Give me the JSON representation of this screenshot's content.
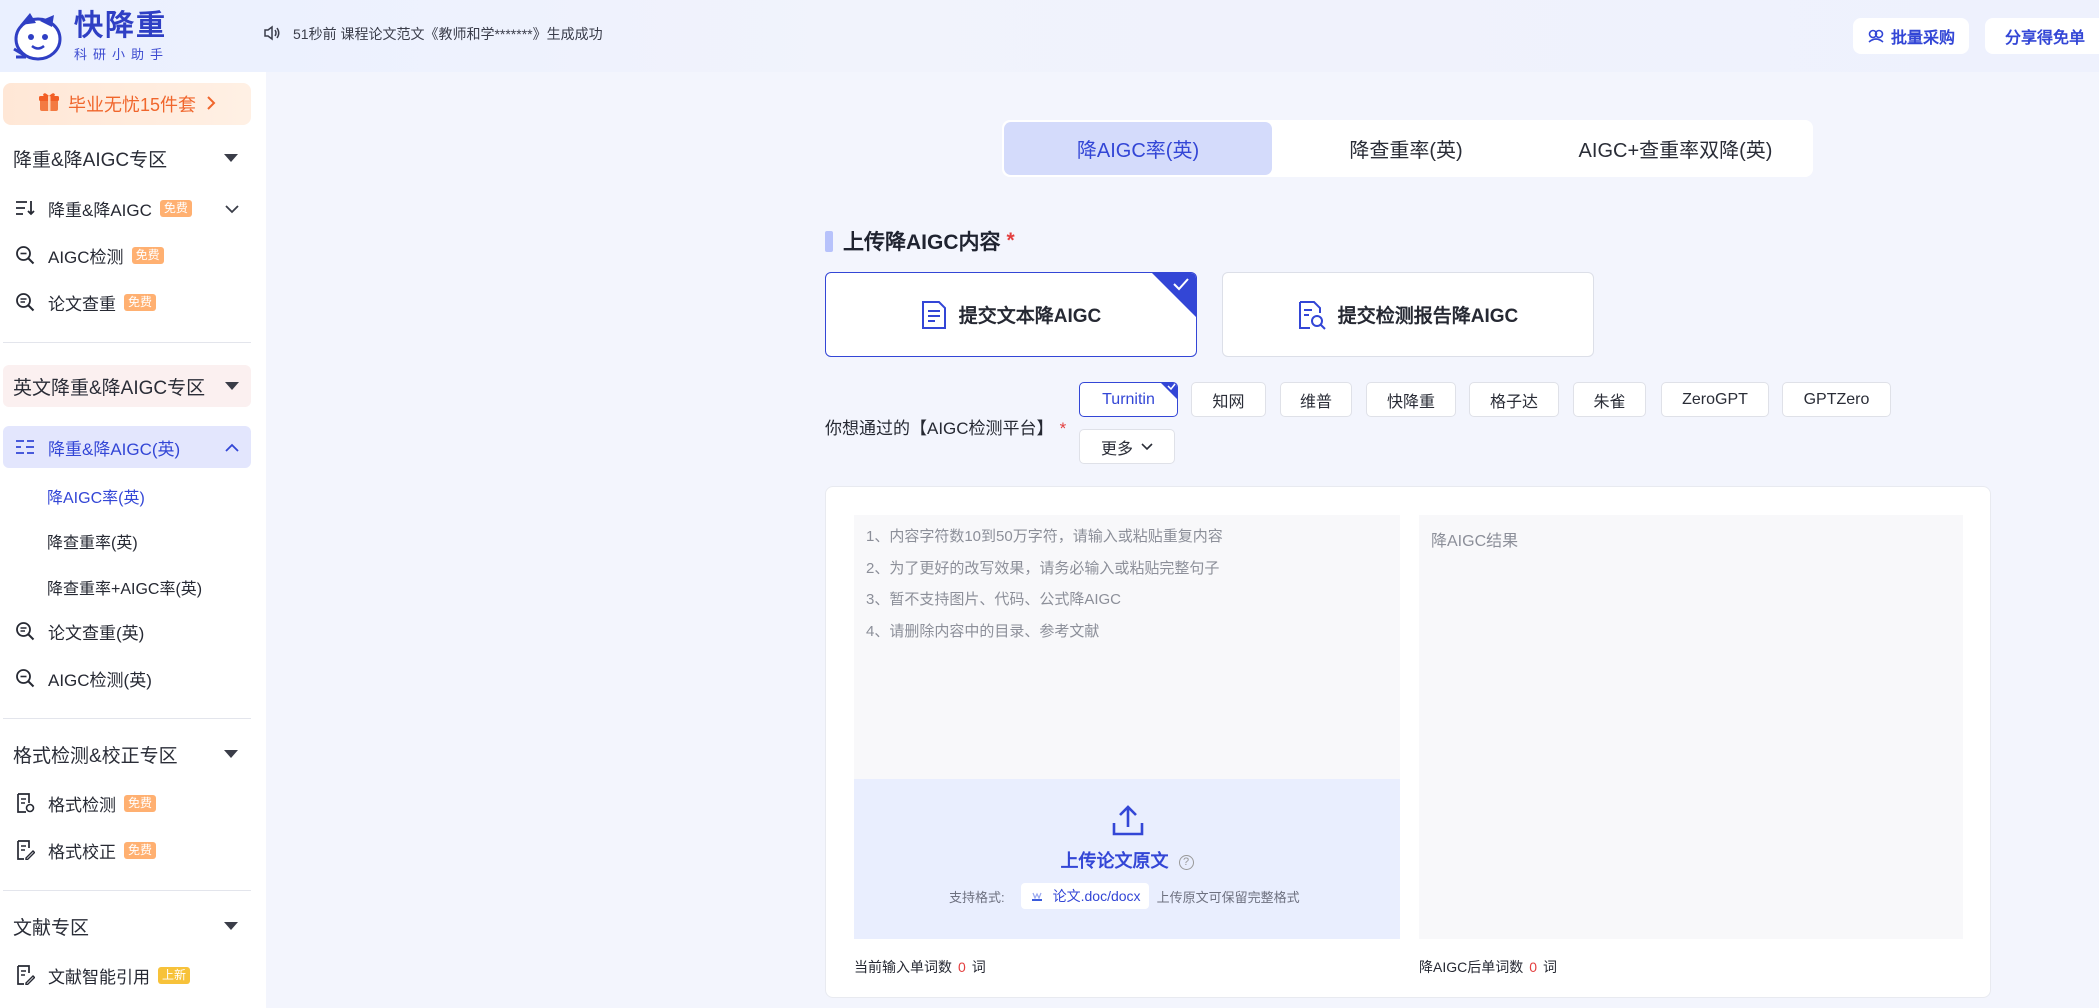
{
  "header": {
    "logo_title": "快降重",
    "logo_sub": "科研小助手",
    "notice": "51秒前 课程论文范文《教师和学*******》生成成功",
    "bulk_label": "批量采购",
    "share_label": "分享得免单"
  },
  "sidebar": {
    "promo_label": "毕业无忧15件套",
    "sections": [
      {
        "title": "降重&降AIGC专区",
        "items": [
          {
            "label": "降重&降AIGC",
            "badge": "免费"
          },
          {
            "label": "AIGC检测",
            "badge": "免费"
          },
          {
            "label": "论文查重",
            "badge": "免费"
          }
        ]
      },
      {
        "title": "英文降重&降AIGC专区",
        "items": [
          {
            "label": "降重&降AIGC(英)"
          },
          {
            "label": "论文查重(英)"
          },
          {
            "label": "AIGC检测(英)"
          }
        ],
        "sub_items": [
          "降AIGC率(英)",
          "降查重率(英)",
          "降查重率+AIGC率(英)"
        ]
      },
      {
        "title": "格式检测&校正专区",
        "items": [
          {
            "label": "格式检测",
            "badge": "免费"
          },
          {
            "label": "格式校正",
            "badge": "免费"
          }
        ]
      },
      {
        "title": "文献专区",
        "items": [
          {
            "label": "文献智能引用",
            "badge": "上新"
          }
        ]
      }
    ]
  },
  "main": {
    "tabs": [
      "降AIGC率(英)",
      "降查重率(英)",
      "AIGC+查重率双降(英)"
    ],
    "section_title": "上传降AIGC内容",
    "required_mark": "*",
    "modes": [
      "提交文本降AIGC",
      "提交检测报告降AIGC"
    ],
    "platform_label": "你想通过的【AIGC检测平台】",
    "platforms": [
      "Turnitin",
      "知网",
      "维普",
      "快降重",
      "格子达",
      "朱雀",
      "ZeroGPT",
      "GPTZero"
    ],
    "more_label": "更多",
    "hints": [
      "1、内容字符数10到50万字符，请输入或粘贴重复内容",
      "2、为了更好的改写效果，请务必输入或粘贴完整句子",
      "3、暂不支持图片、代码、公式降AIGC",
      "4、请删除内容中的目录、参考文献"
    ],
    "upload": {
      "title": "上传论文原文",
      "help": "?",
      "support_label": "支持格式:",
      "format": "论文.doc/docx",
      "note": "上传原文可保留完整格式"
    },
    "result_placeholder": "降AIGC结果",
    "input_count": {
      "prefix": "当前输入单词数",
      "value": "0",
      "suffix": "词"
    },
    "result_count": {
      "prefix": "降AIGC后单词数",
      "value": "0",
      "suffix": "词"
    }
  },
  "colors": {
    "accent": "#3346d6",
    "promo": "#f0662c",
    "badge": "#ffb071",
    "required": "#e33f3f"
  }
}
